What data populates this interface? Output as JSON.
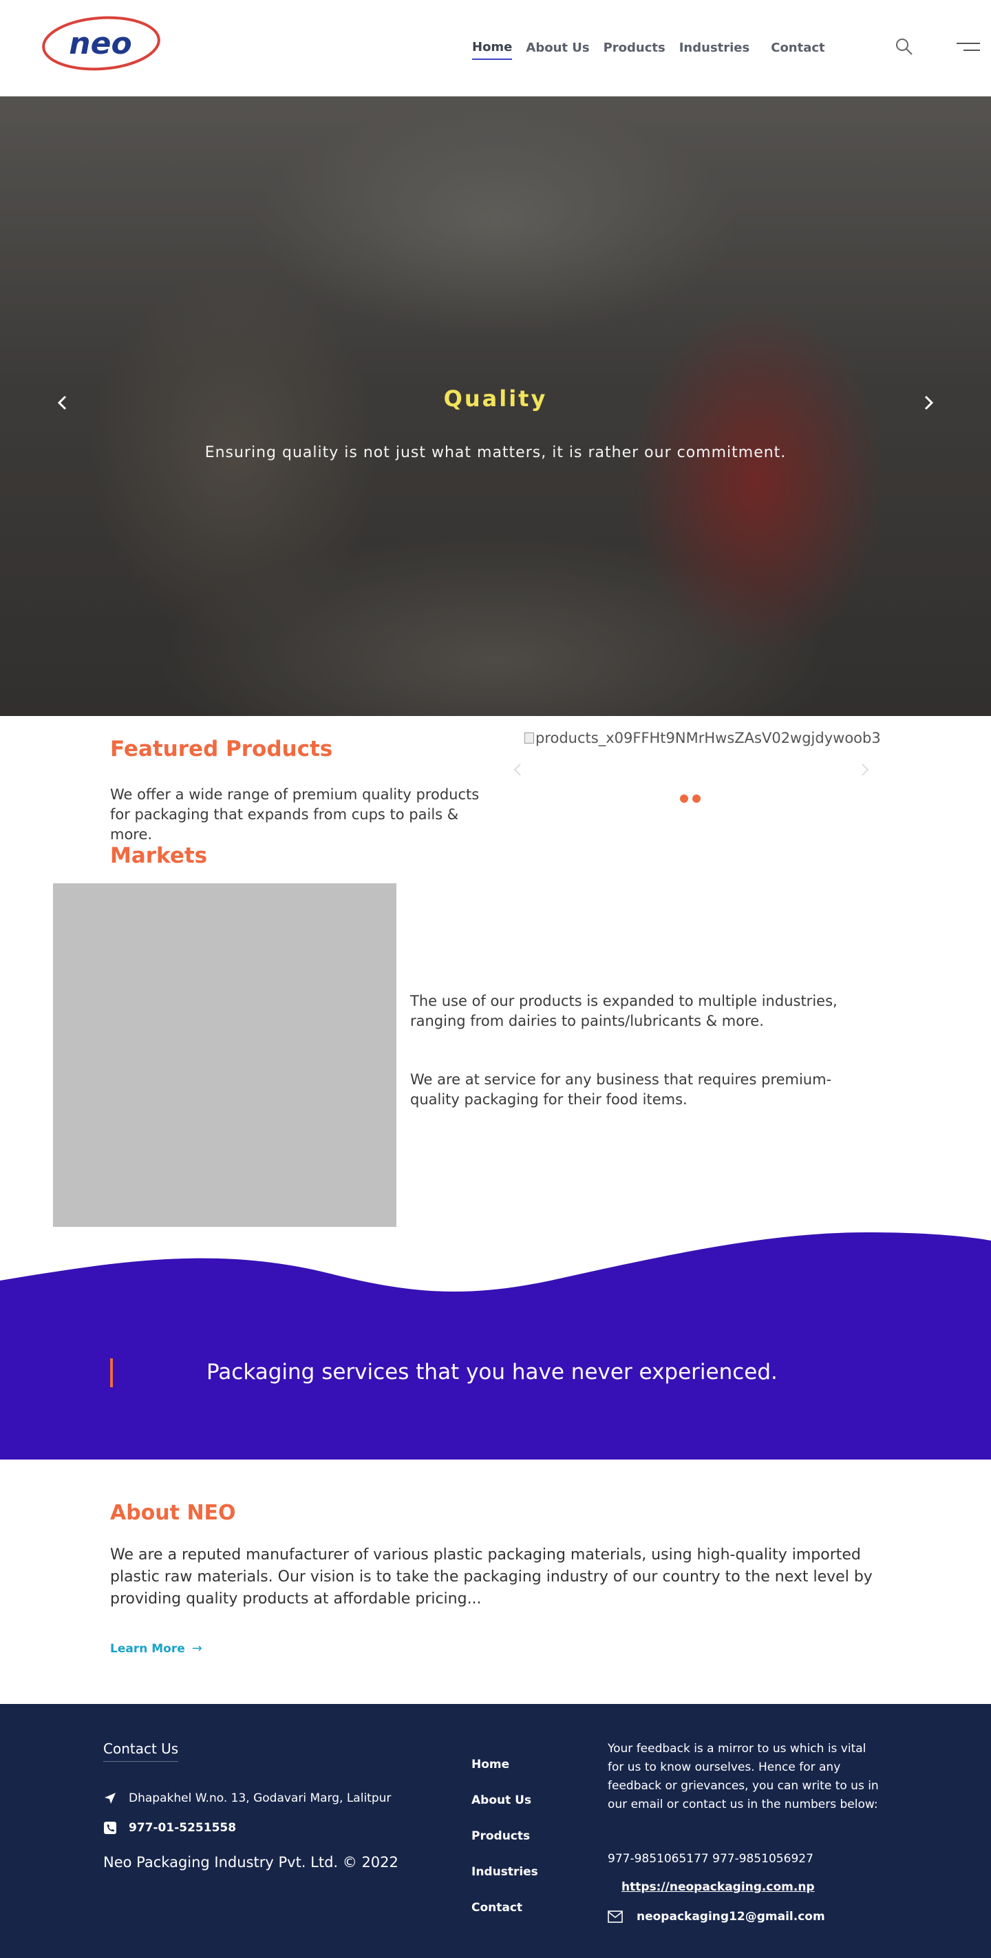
{
  "header": {
    "logo_text": "neo",
    "nav": [
      {
        "label": "Home",
        "active": true
      },
      {
        "label": "About Us",
        "active": false
      },
      {
        "label": "Products",
        "active": false
      },
      {
        "label": "Industries",
        "active": false
      },
      {
        "label": "Contact",
        "active": false
      }
    ],
    "icons": [
      "search-icon",
      "menu-icon"
    ]
  },
  "hero": {
    "title": "Quality",
    "subtitle": "Ensuring quality is not just what matters, it is rather our commitment."
  },
  "featured": {
    "title": "Featured Products",
    "text": "We offer a wide range of premium quality products for packaging that expands from cups to pails & more.",
    "image_alt": "products_x09FFHt9NMrHwsZAsV02wgjdywoob3"
  },
  "markets": {
    "title": "Markets",
    "p1": "The use of our products is expanded to multiple industries, ranging from dairies to paints/lubricants & more.",
    "p2": "We are at service for any business that requires premium-quality packaging for their food items."
  },
  "banner": {
    "text": "Packaging services that you have never experienced."
  },
  "about": {
    "title": "About NEO",
    "text": "We are a reputed manufacturer of various plastic packaging materials, using high-quality imported plastic raw materials. Our vision is to take the packaging industry of our country to the next level by providing quality products at affordable pricing...",
    "learn_more": "Learn More"
  },
  "footer": {
    "contact_title": "Contact Us",
    "address": "Dhapakhel W.no. 13, Godavari Marg, Lalitpur",
    "phone": "977-01-5251558",
    "copyright": "Neo Packaging Industry Pvt. Ltd. © 2022",
    "links": [
      "Home",
      "About Us",
      "Products",
      "Industries",
      "Contact"
    ],
    "feedback": "Your feedback is a mirror to us which is vital for us to know ourselves. Hence for any feedback or grievances, you can write to us in our email or contact us in the numbers below:",
    "phones": "977-9851065177 977-9851056927",
    "website": "https://neopackaging.com.np",
    "email": "neopackaging12@gmail.com"
  },
  "colors": {
    "accent": "#f06a40",
    "hero_title": "#f2e45b",
    "banner": "#3711b5",
    "footer": "#172549",
    "link": "#1aa3c8"
  }
}
